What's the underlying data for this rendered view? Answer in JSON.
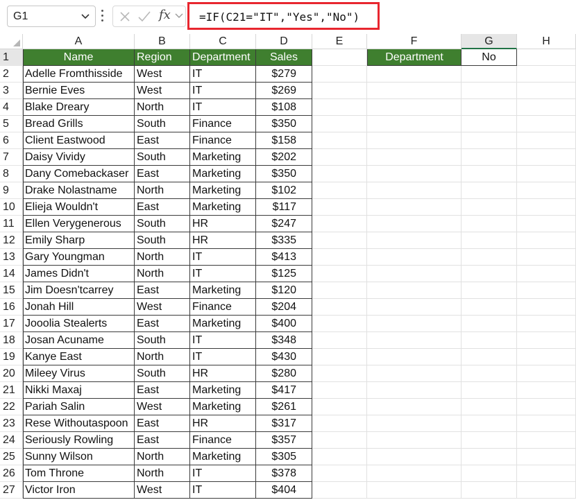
{
  "formula_bar": {
    "name_box": "G1",
    "cancel_icon": "x-icon",
    "enter_icon": "checkmark-icon",
    "function_label": "fx",
    "formula": "=IF(C21=\"IT\",\"Yes\",\"No\")"
  },
  "columns": [
    "A",
    "B",
    "C",
    "D",
    "E",
    "F",
    "G",
    "H"
  ],
  "selected_column": "G",
  "selected_row": 1,
  "table": {
    "headers": [
      "Name",
      "Region",
      "Department",
      "Sales"
    ],
    "rows": [
      [
        "Adelle Fromthisside",
        "West",
        "IT",
        "$279"
      ],
      [
        "Bernie Eves",
        "West",
        "IT",
        "$269"
      ],
      [
        "Blake Dreary",
        "North",
        "IT",
        "$108"
      ],
      [
        "Bread Grills",
        "South",
        "Finance",
        "$350"
      ],
      [
        "Client Eastwood",
        "East",
        "Finance",
        "$158"
      ],
      [
        "Daisy Vividy",
        "South",
        "Marketing",
        "$202"
      ],
      [
        "Dany Comebackaser",
        "East",
        "Marketing",
        "$350"
      ],
      [
        "Drake Nolastname",
        "North",
        "Marketing",
        "$102"
      ],
      [
        "Elieja Wouldn't",
        "East",
        "Marketing",
        "$117"
      ],
      [
        "Ellen Verygenerous",
        "South",
        "HR",
        "$247"
      ],
      [
        "Emily Sharp",
        "South",
        "HR",
        "$335"
      ],
      [
        "Gary Youngman",
        "North",
        "IT",
        "$413"
      ],
      [
        "James Didn't",
        "North",
        "IT",
        "$125"
      ],
      [
        "Jim Doesn'tcarrey",
        "East",
        "Marketing",
        "$120"
      ],
      [
        "Jonah Hill",
        "West",
        "Finance",
        "$204"
      ],
      [
        "Jooolia Stealerts",
        "East",
        "Marketing",
        "$400"
      ],
      [
        "Josan Acuname",
        "South",
        "IT",
        "$348"
      ],
      [
        "Kanye East",
        "North",
        "IT",
        "$430"
      ],
      [
        "Mileey Virus",
        "South",
        "HR",
        "$280"
      ],
      [
        "Nikki Maxaj",
        "East",
        "Marketing",
        "$417"
      ],
      [
        "Pariah Salin",
        "West",
        "Marketing",
        "$261"
      ],
      [
        "Rese Withoutaspoon",
        "East",
        "HR",
        "$317"
      ],
      [
        "Seriously Rowling",
        "East",
        "Finance",
        "$357"
      ],
      [
        "Sunny Wilson",
        "North",
        "Marketing",
        "$305"
      ],
      [
        "Tom Throne",
        "North",
        "IT",
        "$378"
      ],
      [
        "Victor Iron",
        "West",
        "IT",
        "$404"
      ]
    ]
  },
  "lookup": {
    "label": "Department",
    "result": "No"
  },
  "colors": {
    "header_green": "#3f7f2f",
    "highlight_red": "#e8262f",
    "selection_green": "#217346"
  }
}
